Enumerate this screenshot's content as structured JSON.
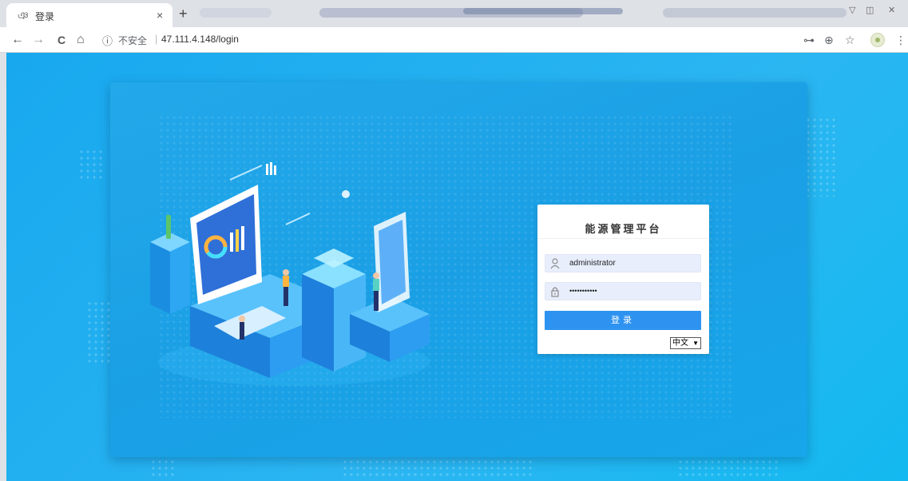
{
  "browser": {
    "tab_title": "登录",
    "tab_close": "×",
    "new_tab": "+",
    "back": "←",
    "forward": "→",
    "reload": "C",
    "home": "⌂",
    "security_label": "不安全",
    "separator": "|",
    "url": "47.111.4.148/login",
    "icons": [
      "key-icon",
      "zoom-icon",
      "star-icon",
      "avatar",
      "menu-icon"
    ]
  },
  "login": {
    "title": "能源管理平台",
    "username_value": "administrator",
    "password_value": "•••••••••••",
    "submit_label": "登录",
    "language": "中文"
  },
  "colors": {
    "background": "#18a8ee",
    "button": "#2e93f0",
    "field": "#e8eefc"
  }
}
